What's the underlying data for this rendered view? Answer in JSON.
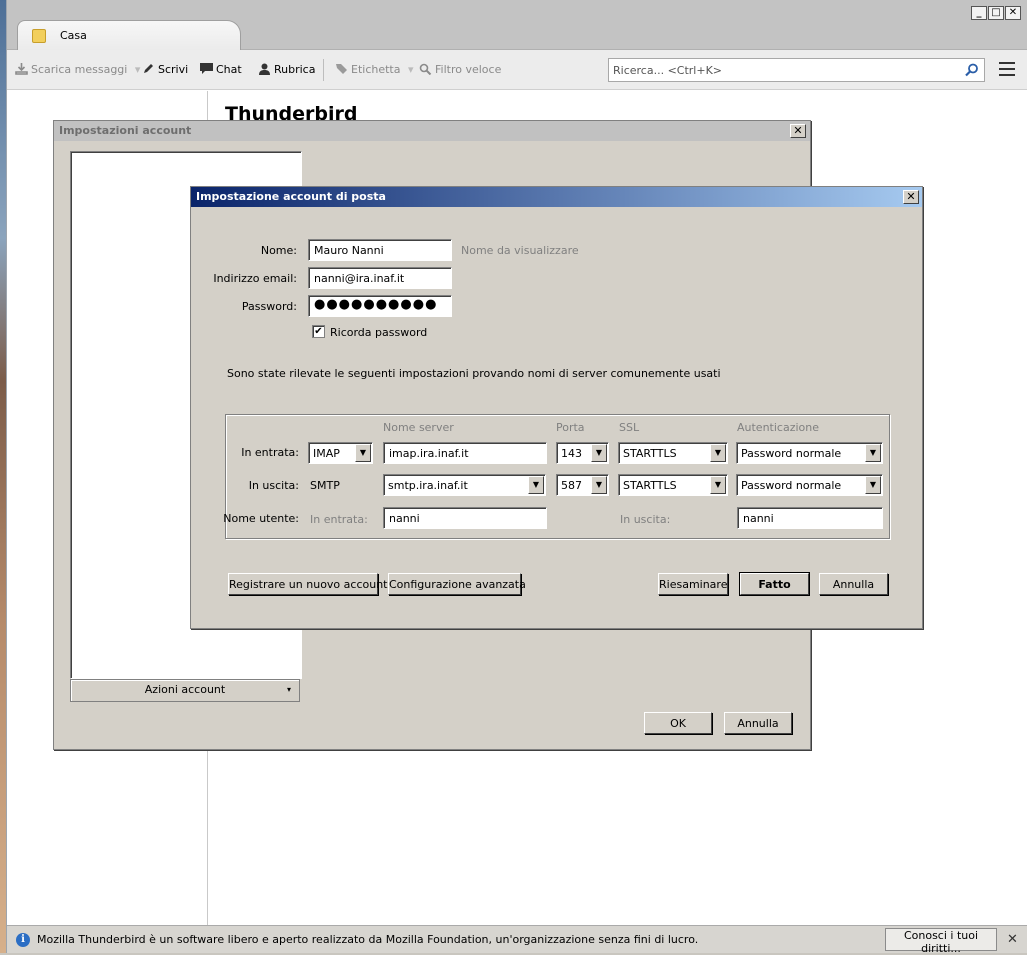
{
  "app": {
    "tab_label": "Casa",
    "window_buttons": {
      "minimize": "_",
      "maximize": "□",
      "close": "✕"
    }
  },
  "toolbar": {
    "get_messages": "Scarica messaggi",
    "write": "Scrivi",
    "chat": "Chat",
    "address_book": "Rubrica",
    "tag": "Etichetta",
    "quick_filter": "Filtro veloce",
    "search_placeholder": "Ricerca... <Ctrl+K>"
  },
  "main": {
    "title": "Thunderbird"
  },
  "account_settings": {
    "title": "Impostazioni account",
    "close": "✕",
    "account_actions": "Azioni account",
    "account_actions_arrow": "▾",
    "ok": "OK",
    "cancel": "Annulla"
  },
  "mail_setup": {
    "title": "Impostazione account di posta",
    "close": "✕",
    "name_label": "Nome:",
    "name_value": "Mauro Nanni",
    "name_hint": "Nome da visualizzare",
    "email_label": "Indirizzo email:",
    "email_value": "nanni@ira.inaf.it",
    "password_label": "Password:",
    "password_value": "●●●●●●●●●●",
    "remember_password": "Ricorda password",
    "remember_checked": "✔",
    "detected_message": "Sono state rilevate le seguenti impostazioni provando nomi di server comunemente usati",
    "headers": {
      "server_name": "Nome server",
      "port": "Porta",
      "ssl": "SSL",
      "auth": "Autenticazione"
    },
    "incoming": {
      "label": "In entrata:",
      "protocol": "IMAP",
      "server": "imap.ira.inaf.it",
      "port": "143",
      "ssl": "STARTTLS",
      "auth": "Password normale"
    },
    "outgoing": {
      "label": "In uscita:",
      "protocol": "SMTP",
      "server": "smtp.ira.inaf.it",
      "port": "587",
      "ssl": "STARTTLS",
      "auth": "Password normale"
    },
    "username": {
      "label": "Nome utente:",
      "incoming_label": "In entrata:",
      "incoming_value": "nanni",
      "outgoing_label": "In uscita:",
      "outgoing_value": "nanni"
    },
    "buttons": {
      "new_account": "Registrare un nuovo account",
      "advanced": "Configurazione avanzata",
      "retest": "Riesaminare",
      "done": "Fatto",
      "cancel": "Annulla"
    }
  },
  "statusbar": {
    "info_icon": "i",
    "message": "Mozilla Thunderbird è un software libero e aperto realizzato da Mozilla Foundation, un'organizzazione senza fini di lucro.",
    "know_rights": "Conosci i tuoi diritti...",
    "close": "✕"
  },
  "colors": {
    "dialog_bg": "#d4d0c8",
    "title_active_start": "#0a246a",
    "title_active_end": "#a6caf0",
    "title_inactive": "#c1c1c1"
  }
}
